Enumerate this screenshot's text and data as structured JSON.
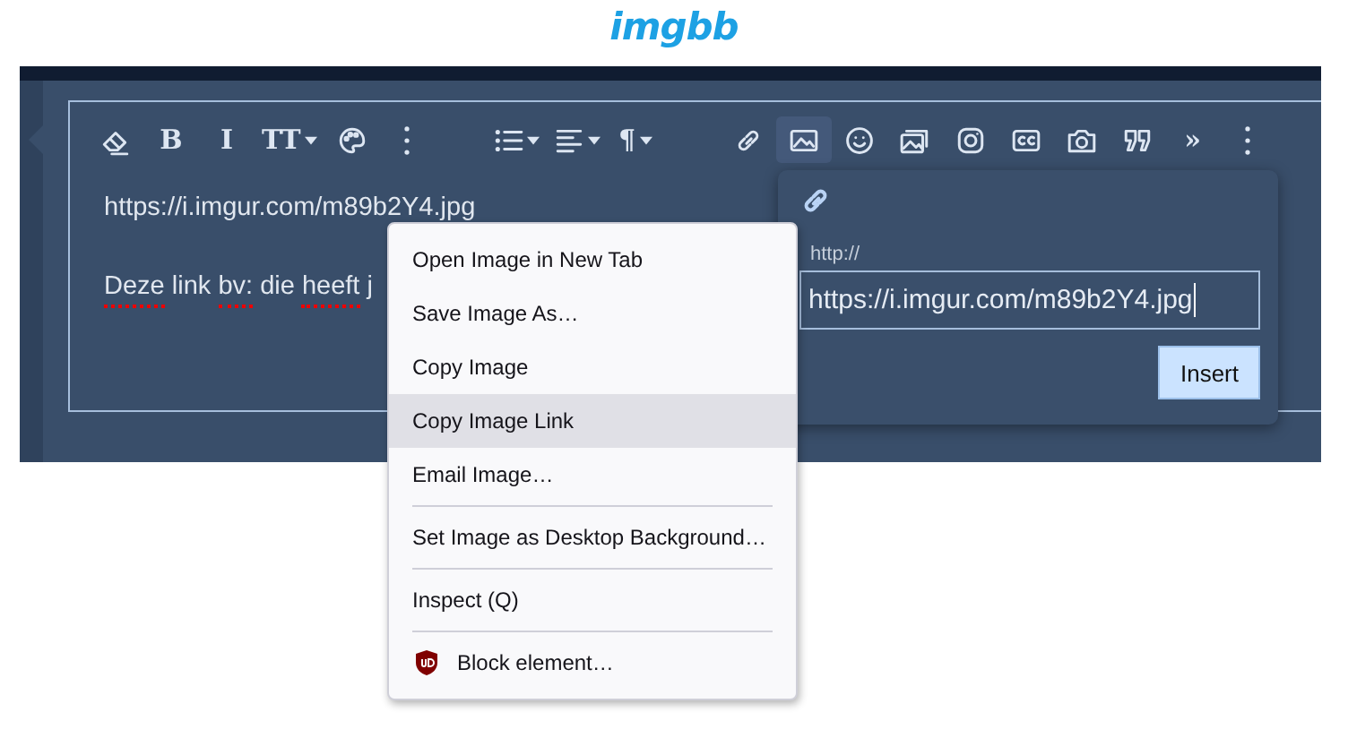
{
  "logo": "imgbb",
  "toolbar": [
    {
      "items": [
        {
          "kind": "eraser",
          "dropdown": false,
          "active": false
        },
        {
          "kind": "text",
          "label": "B",
          "dropdown": false,
          "active": false
        },
        {
          "kind": "text",
          "label": "I",
          "dropdown": false,
          "active": false
        },
        {
          "kind": "text",
          "label": "TT",
          "dropdown": true,
          "active": false
        },
        {
          "kind": "palette",
          "dropdown": false,
          "active": false
        },
        {
          "kind": "more",
          "dropdown": false,
          "active": false
        }
      ]
    },
    {
      "items": [
        {
          "kind": "list",
          "dropdown": true,
          "active": false
        },
        {
          "kind": "align",
          "dropdown": true,
          "active": false
        },
        {
          "kind": "text",
          "label": "¶",
          "dropdown": true,
          "active": false
        }
      ]
    },
    {
      "items": [
        {
          "kind": "link",
          "dropdown": false,
          "active": false
        },
        {
          "kind": "image",
          "dropdown": false,
          "active": true
        },
        {
          "kind": "smiley",
          "dropdown": false,
          "active": false
        },
        {
          "kind": "gallery",
          "dropdown": false,
          "active": false
        },
        {
          "kind": "instagram",
          "dropdown": false,
          "active": false
        },
        {
          "kind": "cc",
          "dropdown": false,
          "active": false
        },
        {
          "kind": "camera",
          "dropdown": false,
          "active": false
        },
        {
          "kind": "quote",
          "dropdown": false,
          "active": false
        },
        {
          "kind": "text",
          "label": "»",
          "dropdown": false,
          "active": false
        },
        {
          "kind": "more",
          "dropdown": false,
          "active": false
        }
      ]
    }
  ],
  "editor": {
    "lines": [
      [
        {
          "text": "https://i.imgur.com/m89b2Y4.jpg",
          "misspelled": false
        }
      ],
      [
        {
          "text": "Deze",
          "misspelled": true
        },
        {
          "text": "link",
          "misspelled": false
        },
        {
          "text": "bv:",
          "misspelled": true
        },
        {
          "text": "die",
          "misspelled": false
        },
        {
          "text": "heeft",
          "misspelled": true
        },
        {
          "text": "j",
          "misspelled": false
        }
      ]
    ]
  },
  "link_popup": {
    "label": "http://",
    "value": "https://i.imgur.com/m89b2Y4.jpg",
    "button": "Insert"
  },
  "context_menu": {
    "items": [
      {
        "kind": "item",
        "label": "Open Image in New Tab",
        "selected": false
      },
      {
        "kind": "item",
        "label": "Save Image As…",
        "selected": false
      },
      {
        "kind": "item",
        "label": "Copy Image",
        "selected": false
      },
      {
        "kind": "item",
        "label": "Copy Image Link",
        "selected": true
      },
      {
        "kind": "item",
        "label": "Email Image…",
        "selected": false
      },
      {
        "kind": "separator"
      },
      {
        "kind": "item",
        "label": "Set Image as Desktop Background…",
        "selected": false
      },
      {
        "kind": "separator"
      },
      {
        "kind": "item",
        "label": "Inspect (Q)",
        "selected": false
      },
      {
        "kind": "separator"
      },
      {
        "kind": "addon",
        "label": "Block element…",
        "selected": false
      }
    ]
  }
}
